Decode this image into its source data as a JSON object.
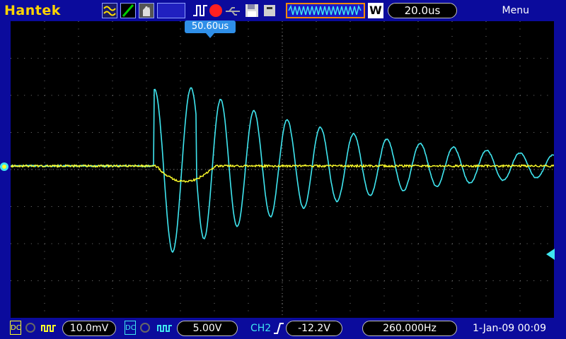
{
  "header": {
    "brand": "Hantek",
    "menu_label": "Menu",
    "timebase": "20.0us",
    "timebase_mode": "W"
  },
  "screen": {
    "trigger_position": "50.60us"
  },
  "footer": {
    "ch1_coupling": "DC",
    "ch1_scale": "10.0mV",
    "ch2_coupling": "DC",
    "ch2_scale": "5.00V",
    "trigger_source": "CH2",
    "trigger_level": "-12.2V",
    "frequency": "260.000Hz",
    "datetime": "1-Jan-09 00:09"
  },
  "colors": {
    "ch1": "#ffff2a",
    "ch2": "#3fe6f0",
    "frame": "#0b0b9c",
    "trig_marker": "#2f8fe8"
  }
}
